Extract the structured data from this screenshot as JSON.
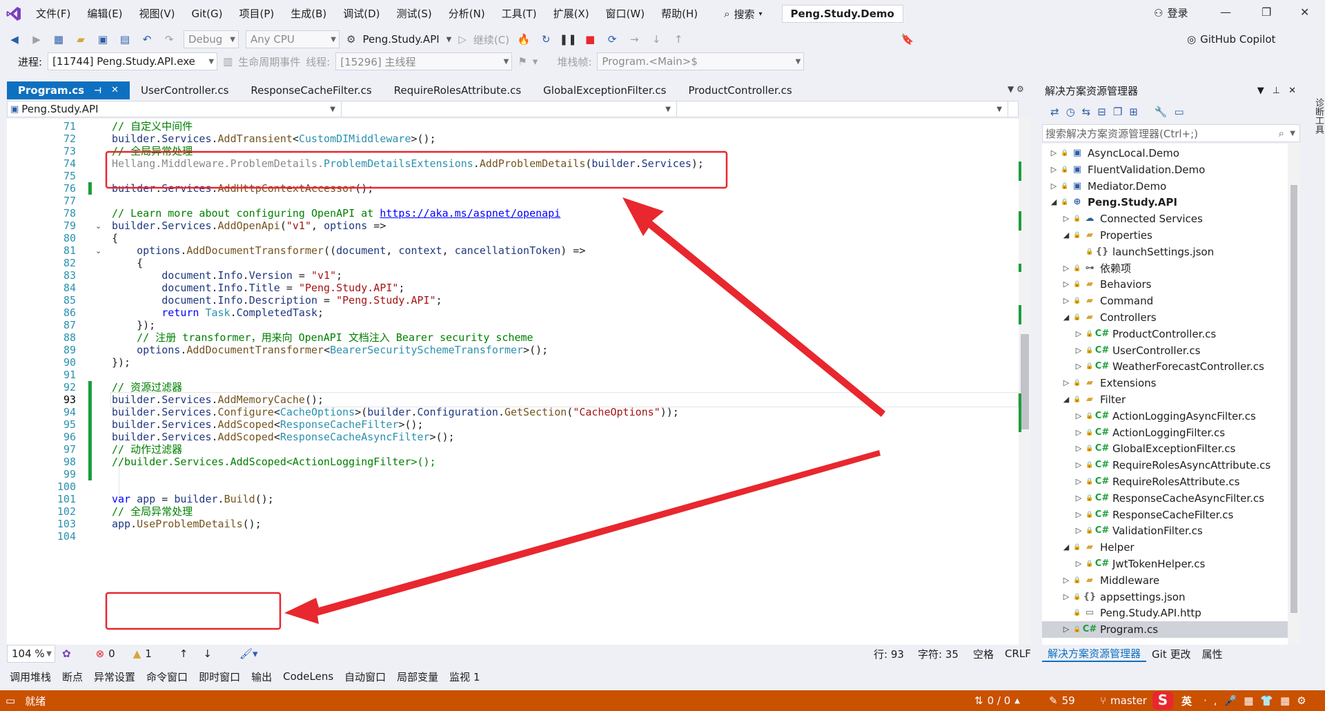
{
  "titlebar": {
    "menus": [
      "文件(F)",
      "编辑(E)",
      "视图(V)",
      "Git(G)",
      "项目(P)",
      "生成(B)",
      "调试(D)",
      "测试(S)",
      "分析(N)",
      "工具(T)",
      "扩展(X)",
      "窗口(W)",
      "帮助(H)"
    ],
    "search_label": "搜索",
    "solution_name": "Peng.Study.Demo",
    "login_label": "登录"
  },
  "toolbar": {
    "config": "Debug",
    "platform": "Any CPU",
    "startup_project": "Peng.Study.API",
    "continue_label": "继续(C)",
    "copilot_label": "GitHub Copilot"
  },
  "debug_toolbar": {
    "process_label": "进程:",
    "process_value": "[11744] Peng.Study.API.exe",
    "lifecycle_label": "生命周期事件",
    "thread_label": "线程:",
    "thread_value": "[15296] 主线程",
    "stackframe_label": "堆栈帧:",
    "stackframe_value": "Program.<Main>$"
  },
  "tabs": [
    {
      "label": "Program.cs",
      "active": true
    },
    {
      "label": "UserController.cs",
      "active": false
    },
    {
      "label": "ResponseCacheFilter.cs",
      "active": false
    },
    {
      "label": "RequireRolesAttribute.cs",
      "active": false
    },
    {
      "label": "GlobalExceptionFilter.cs",
      "active": false
    },
    {
      "label": "ProductController.cs",
      "active": false
    }
  ],
  "navbar": {
    "project": "Peng.Study.API"
  },
  "editor": {
    "current_line": 93,
    "lines": [
      {
        "n": "71",
        "tokens": [
          [
            "cm",
            "// 自定义中间件"
          ]
        ]
      },
      {
        "n": "72",
        "tokens": [
          [
            "id",
            "builder"
          ],
          [
            "",
            "."
          ],
          [
            "id",
            "Services"
          ],
          [
            "",
            "."
          ],
          [
            "mt",
            "AddTransient"
          ],
          [
            "",
            "<"
          ],
          [
            "ty",
            "CustomDIMiddleware"
          ],
          [
            "",
            ">();"
          ]
        ]
      },
      {
        "n": "73",
        "tokens": [
          [
            "cm",
            "// 全局异常处理"
          ]
        ]
      },
      {
        "n": "74",
        "tokens": [
          [
            "dim",
            "Hellang.Middleware.ProblemDetails."
          ],
          [
            "ty",
            "ProblemDetailsExtensions"
          ],
          [
            "",
            "."
          ],
          [
            "mt",
            "AddProblemDetails"
          ],
          [
            "",
            "("
          ],
          [
            "id",
            "builder"
          ],
          [
            "",
            "."
          ],
          [
            "id",
            "Services"
          ],
          [
            "",
            ");"
          ]
        ]
      },
      {
        "n": "75",
        "tokens": []
      },
      {
        "n": "76",
        "tokens": [
          [
            "id",
            "builder"
          ],
          [
            "",
            "."
          ],
          [
            "id",
            "Services"
          ],
          [
            "",
            "."
          ],
          [
            "mt",
            "AddHttpContextAccessor"
          ],
          [
            "",
            "();"
          ]
        ]
      },
      {
        "n": "77",
        "tokens": []
      },
      {
        "n": "78",
        "tokens": [
          [
            "cm",
            "// Learn more about configuring OpenAPI at "
          ],
          [
            "link",
            "https://aka.ms/aspnet/openapi"
          ]
        ]
      },
      {
        "n": "79",
        "tokens": [
          [
            "id",
            "builder"
          ],
          [
            "",
            "."
          ],
          [
            "id",
            "Services"
          ],
          [
            "",
            "."
          ],
          [
            "mt",
            "AddOpenApi"
          ],
          [
            "",
            "("
          ],
          [
            "str",
            "\"v1\""
          ],
          [
            "",
            ", "
          ],
          [
            "id",
            "options"
          ],
          [
            "",
            " =>"
          ]
        ]
      },
      {
        "n": "80",
        "tokens": [
          [
            "",
            "{"
          ]
        ]
      },
      {
        "n": "81",
        "tokens": [
          [
            "",
            "    "
          ],
          [
            "id",
            "options"
          ],
          [
            "",
            "."
          ],
          [
            "mt",
            "AddDocumentTransformer"
          ],
          [
            "",
            "(("
          ],
          [
            "id",
            "document"
          ],
          [
            "",
            ", "
          ],
          [
            "id",
            "context"
          ],
          [
            "",
            ", "
          ],
          [
            "id",
            "cancellationToken"
          ],
          [
            "",
            ") =>"
          ]
        ]
      },
      {
        "n": "82",
        "tokens": [
          [
            "",
            "    {"
          ]
        ]
      },
      {
        "n": "83",
        "tokens": [
          [
            "",
            "        "
          ],
          [
            "id",
            "document"
          ],
          [
            "",
            "."
          ],
          [
            "id",
            "Info"
          ],
          [
            "",
            "."
          ],
          [
            "id",
            "Version"
          ],
          [
            "",
            " = "
          ],
          [
            "str",
            "\"v1\""
          ],
          [
            "",
            ";"
          ]
        ]
      },
      {
        "n": "84",
        "tokens": [
          [
            "",
            "        "
          ],
          [
            "id",
            "document"
          ],
          [
            "",
            "."
          ],
          [
            "id",
            "Info"
          ],
          [
            "",
            "."
          ],
          [
            "id",
            "Title"
          ],
          [
            "",
            " = "
          ],
          [
            "str",
            "\"Peng.Study.API\""
          ],
          [
            "",
            ";"
          ]
        ]
      },
      {
        "n": "85",
        "tokens": [
          [
            "",
            "        "
          ],
          [
            "id",
            "document"
          ],
          [
            "",
            "."
          ],
          [
            "id",
            "Info"
          ],
          [
            "",
            "."
          ],
          [
            "id",
            "Description"
          ],
          [
            "",
            " = "
          ],
          [
            "str",
            "\"Peng.Study.API\""
          ],
          [
            "",
            ";"
          ]
        ]
      },
      {
        "n": "86",
        "tokens": [
          [
            "",
            "        "
          ],
          [
            "kw",
            "return"
          ],
          [
            "",
            " "
          ],
          [
            "ty",
            "Task"
          ],
          [
            "",
            "."
          ],
          [
            "id",
            "CompletedTask"
          ],
          [
            "",
            ";"
          ]
        ]
      },
      {
        "n": "87",
        "tokens": [
          [
            "",
            "    });"
          ]
        ]
      },
      {
        "n": "88",
        "tokens": [
          [
            "",
            "    "
          ],
          [
            "cm",
            "// 注册 transformer，用来向 OpenAPI 文档注入 Bearer security scheme"
          ]
        ]
      },
      {
        "n": "89",
        "tokens": [
          [
            "",
            "    "
          ],
          [
            "id",
            "options"
          ],
          [
            "",
            "."
          ],
          [
            "mt",
            "AddDocumentTransformer"
          ],
          [
            "",
            "<"
          ],
          [
            "ty",
            "BearerSecuritySchemeTransformer"
          ],
          [
            "",
            ">();"
          ]
        ]
      },
      {
        "n": "90",
        "tokens": [
          [
            "",
            "});"
          ]
        ]
      },
      {
        "n": "91",
        "tokens": []
      },
      {
        "n": "92",
        "tokens": [
          [
            "cm",
            "// 资源过滤器"
          ]
        ]
      },
      {
        "n": "93",
        "tokens": [
          [
            "id",
            "builder"
          ],
          [
            "",
            "."
          ],
          [
            "id",
            "Services"
          ],
          [
            "",
            "."
          ],
          [
            "mt",
            "AddMemoryCache"
          ],
          [
            "",
            "();"
          ]
        ]
      },
      {
        "n": "94",
        "tokens": [
          [
            "id",
            "builder"
          ],
          [
            "",
            "."
          ],
          [
            "id",
            "Services"
          ],
          [
            "",
            "."
          ],
          [
            "mt",
            "Configure"
          ],
          [
            "",
            "<"
          ],
          [
            "ty",
            "CacheOptions"
          ],
          [
            "",
            ">("
          ],
          [
            "id",
            "builder"
          ],
          [
            "",
            "."
          ],
          [
            "id",
            "Configuration"
          ],
          [
            "",
            "."
          ],
          [
            "mt",
            "GetSection"
          ],
          [
            "",
            "("
          ],
          [
            "str",
            "\"CacheOptions\""
          ],
          [
            "",
            "));"
          ]
        ]
      },
      {
        "n": "95",
        "tokens": [
          [
            "id",
            "builder"
          ],
          [
            "",
            "."
          ],
          [
            "id",
            "Services"
          ],
          [
            "",
            "."
          ],
          [
            "mt",
            "AddScoped"
          ],
          [
            "",
            "<"
          ],
          [
            "ty",
            "ResponseCacheFilter"
          ],
          [
            "",
            ">();"
          ]
        ]
      },
      {
        "n": "96",
        "tokens": [
          [
            "id",
            "builder"
          ],
          [
            "",
            "."
          ],
          [
            "id",
            "Services"
          ],
          [
            "",
            "."
          ],
          [
            "mt",
            "AddScoped"
          ],
          [
            "",
            "<"
          ],
          [
            "ty",
            "ResponseCacheAsyncFilter"
          ],
          [
            "",
            ">();"
          ]
        ]
      },
      {
        "n": "97",
        "tokens": [
          [
            "cm",
            "// 动作过滤器"
          ]
        ]
      },
      {
        "n": "98",
        "tokens": [
          [
            "cm",
            "//builder.Services.AddScoped<ActionLoggingFilter>();"
          ]
        ]
      },
      {
        "n": "99",
        "tokens": []
      },
      {
        "n": "100",
        "tokens": []
      },
      {
        "n": "101",
        "tokens": [
          [
            "kw",
            "var"
          ],
          [
            "",
            " "
          ],
          [
            "id",
            "app"
          ],
          [
            "",
            " = "
          ],
          [
            "id",
            "builder"
          ],
          [
            "",
            "."
          ],
          [
            "mt",
            "Build"
          ],
          [
            "",
            "();"
          ]
        ]
      },
      {
        "n": "102",
        "tokens": [
          [
            "cm",
            "// 全局异常处理"
          ]
        ]
      },
      {
        "n": "103",
        "tokens": [
          [
            "id",
            "app"
          ],
          [
            "",
            "."
          ],
          [
            "mt",
            "UseProblemDetails"
          ],
          [
            "",
            "();"
          ]
        ]
      },
      {
        "n": "104",
        "tokens": []
      }
    ]
  },
  "editor_status": {
    "zoom": "104 %",
    "errors": "0",
    "warnings": "1",
    "line": "行: 93",
    "column": "字符: 35",
    "whitespace": "空格",
    "line_ending": "CRLF"
  },
  "solution_explorer": {
    "title": "解决方案资源管理器",
    "search_placeholder": "搜索解决方案资源管理器(Ctrl+;)",
    "items": [
      {
        "label": "AsyncLocal.Demo",
        "level": 0,
        "twisty": "▷",
        "icon": "proj",
        "bold": false
      },
      {
        "label": "FluentValidation.Demo",
        "level": 0,
        "twisty": "▷",
        "icon": "proj",
        "bold": false
      },
      {
        "label": "Mediator.Demo",
        "level": 0,
        "twisty": "▷",
        "icon": "proj",
        "bold": false
      },
      {
        "label": "Peng.Study.API",
        "level": 0,
        "twisty": "◢",
        "icon": "web",
        "bold": true
      },
      {
        "label": "Connected Services",
        "level": 1,
        "twisty": "▷",
        "icon": "cloud",
        "bold": false
      },
      {
        "label": "Properties",
        "level": 1,
        "twisty": "◢",
        "icon": "folder",
        "bold": false
      },
      {
        "label": "launchSettings.json",
        "level": 2,
        "twisty": "",
        "icon": "json",
        "bold": false
      },
      {
        "label": "依赖项",
        "level": 1,
        "twisty": "▷",
        "icon": "deps",
        "bold": false
      },
      {
        "label": "Behaviors",
        "level": 1,
        "twisty": "▷",
        "icon": "folder",
        "bold": false
      },
      {
        "label": "Command",
        "level": 1,
        "twisty": "▷",
        "icon": "folder",
        "bold": false
      },
      {
        "label": "Controllers",
        "level": 1,
        "twisty": "◢",
        "icon": "folder",
        "bold": false
      },
      {
        "label": "ProductController.cs",
        "level": 2,
        "twisty": "▷",
        "icon": "cs",
        "bold": false
      },
      {
        "label": "UserController.cs",
        "level": 2,
        "twisty": "▷",
        "icon": "cs",
        "bold": false
      },
      {
        "label": "WeatherForecastController.cs",
        "level": 2,
        "twisty": "▷",
        "icon": "cs",
        "bold": false
      },
      {
        "label": "Extensions",
        "level": 1,
        "twisty": "▷",
        "icon": "folder",
        "bold": false
      },
      {
        "label": "Filter",
        "level": 1,
        "twisty": "◢",
        "icon": "folder",
        "bold": false
      },
      {
        "label": "ActionLoggingAsyncFilter.cs",
        "level": 2,
        "twisty": "▷",
        "icon": "cs",
        "bold": false
      },
      {
        "label": "ActionLoggingFilter.cs",
        "level": 2,
        "twisty": "▷",
        "icon": "cs",
        "bold": false
      },
      {
        "label": "GlobalExceptionFilter.cs",
        "level": 2,
        "twisty": "▷",
        "icon": "cs",
        "bold": false
      },
      {
        "label": "RequireRolesAsyncAttribute.cs",
        "level": 2,
        "twisty": "▷",
        "icon": "cs",
        "bold": false
      },
      {
        "label": "RequireRolesAttribute.cs",
        "level": 2,
        "twisty": "▷",
        "icon": "cs",
        "bold": false
      },
      {
        "label": "ResponseCacheAsyncFilter.cs",
        "level": 2,
        "twisty": "▷",
        "icon": "cs",
        "bold": false
      },
      {
        "label": "ResponseCacheFilter.cs",
        "level": 2,
        "twisty": "▷",
        "icon": "cs",
        "bold": false
      },
      {
        "label": "ValidationFilter.cs",
        "level": 2,
        "twisty": "▷",
        "icon": "cs",
        "bold": false
      },
      {
        "label": "Helper",
        "level": 1,
        "twisty": "◢",
        "icon": "folder",
        "bold": false
      },
      {
        "label": "JwtTokenHelper.cs",
        "level": 2,
        "twisty": "▷",
        "icon": "cs",
        "bold": false
      },
      {
        "label": "Middleware",
        "level": 1,
        "twisty": "▷",
        "icon": "folder",
        "bold": false
      },
      {
        "label": "appsettings.json",
        "level": 1,
        "twisty": "▷",
        "icon": "json",
        "bold": false
      },
      {
        "label": "Peng.Study.API.http",
        "level": 1,
        "twisty": "",
        "icon": "file",
        "bold": false
      },
      {
        "label": "Program.cs",
        "level": 1,
        "twisty": "▷",
        "icon": "cs",
        "bold": false,
        "selected": true
      }
    ],
    "bottom_tabs": [
      "解决方案资源管理器",
      "Git 更改",
      "属性"
    ],
    "side_rail": "诊断工具"
  },
  "bottom_tabs": [
    "调用堆栈",
    "断点",
    "异常设置",
    "命令窗口",
    "即时窗口",
    "输出",
    "CodeLens",
    "自动窗口",
    "局部变量",
    "监视 1"
  ],
  "statusbar": {
    "state": "就绪",
    "sync": "0 / 0",
    "edits": "59",
    "branch": "master",
    "ime": "英"
  },
  "colors": {
    "accent": "#0e70c0",
    "status_bar": "#ca5100",
    "annotation": "#e8272e"
  }
}
